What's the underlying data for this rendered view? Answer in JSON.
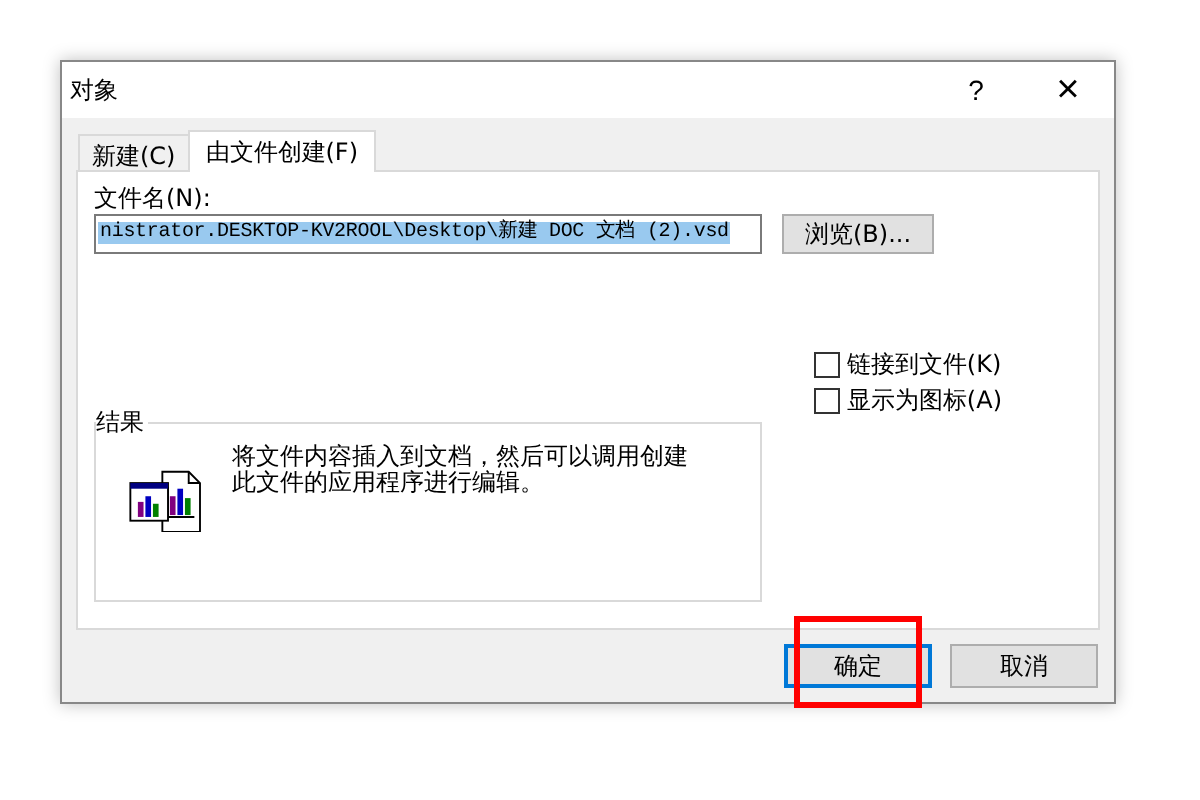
{
  "window": {
    "title": "对象",
    "help": "?",
    "close": "×"
  },
  "tabs": [
    {
      "label": "新建(C)",
      "selected": false
    },
    {
      "label": "由文件创建(F)",
      "selected": true
    }
  ],
  "file_name": {
    "label": "文件名(N):",
    "value": "nistrator.DESKTOP-KV2ROOL\\Desktop\\新建 DOC 文档 (2).vsd",
    "selected": true
  },
  "browse_button": "浏览(B)...",
  "options": [
    {
      "label": "链接到文件(K)",
      "checked": false
    },
    {
      "label": "显示为图标(A)",
      "checked": false
    }
  ],
  "result": {
    "title": "结果",
    "text": "将文件内容插入到文档，然后可以调用创建此文件的应用程序进行编辑。"
  },
  "buttons": [
    {
      "label": "确定",
      "default": true,
      "highlighted": true
    },
    {
      "label": "取消",
      "default": false,
      "highlighted": false
    }
  ]
}
